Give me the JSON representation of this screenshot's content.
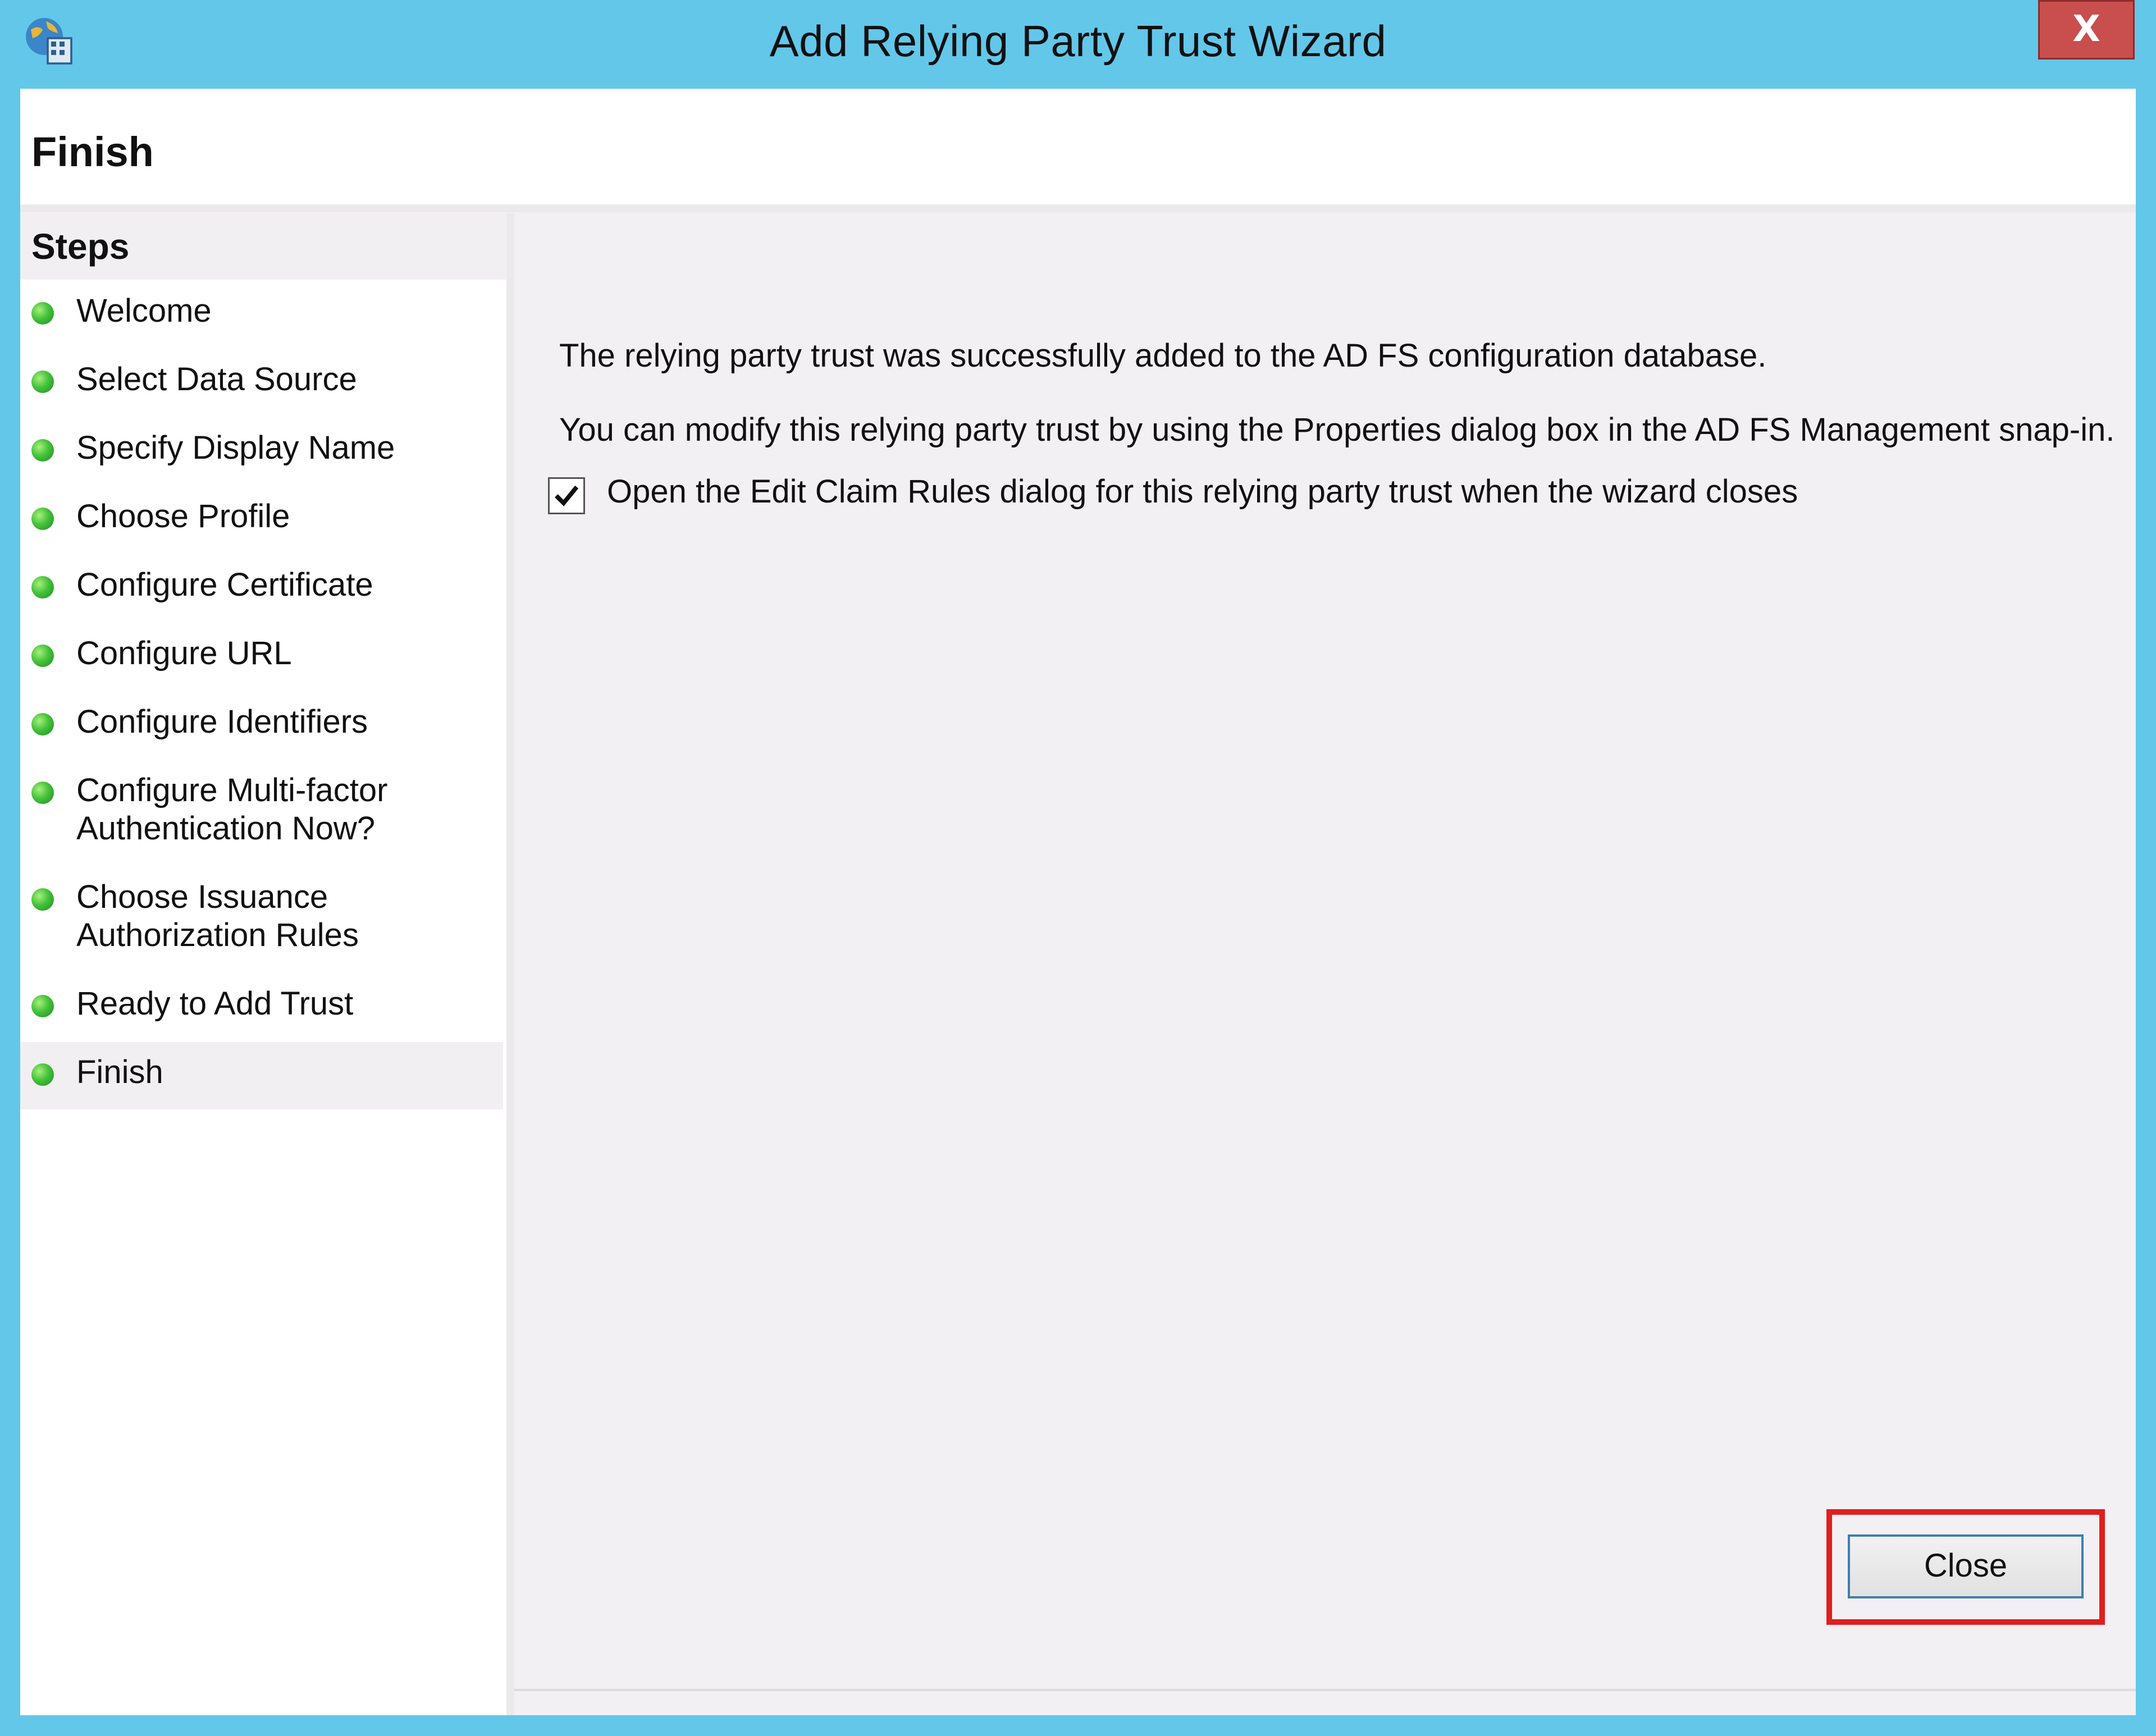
{
  "window": {
    "title": "Add Relying Party Trust Wizard",
    "close_symbol": "X"
  },
  "header": {
    "title": "Finish"
  },
  "steps": {
    "heading": "Steps",
    "items": [
      {
        "label": "Welcome",
        "status": "complete"
      },
      {
        "label": "Select Data Source",
        "status": "complete"
      },
      {
        "label": "Specify Display Name",
        "status": "complete"
      },
      {
        "label": "Choose Profile",
        "status": "complete"
      },
      {
        "label": "Configure Certificate",
        "status": "complete"
      },
      {
        "label": "Configure URL",
        "status": "complete"
      },
      {
        "label": "Configure Identifiers",
        "status": "complete"
      },
      {
        "label": "Configure Multi-factor\nAuthentication Now?",
        "status": "complete"
      },
      {
        "label": "Choose Issuance\nAuthorization Rules",
        "status": "complete"
      },
      {
        "label": "Ready to Add Trust",
        "status": "complete"
      },
      {
        "label": "Finish",
        "status": "current"
      }
    ]
  },
  "content": {
    "success_message": "The relying party trust was successfully added to the AD FS configuration database.",
    "modify_message": "You can modify this relying party trust by using the Properties dialog box in the AD FS Management snap-in.",
    "edit_claim_rules_checkbox": {
      "label": "Open the Edit Claim Rules dialog for this relying party trust when the wizard closes",
      "checked": true
    }
  },
  "footer": {
    "close_label": "Close"
  },
  "colors": {
    "titlebar": "#63c7ea",
    "close_window": "#c94e4e",
    "step_dot": "#45c23a",
    "highlight": "#e01f1f"
  },
  "icons": {
    "app": "adfs-globe-icon",
    "step_status": "green-dot-icon",
    "check": "checkmark-icon"
  }
}
